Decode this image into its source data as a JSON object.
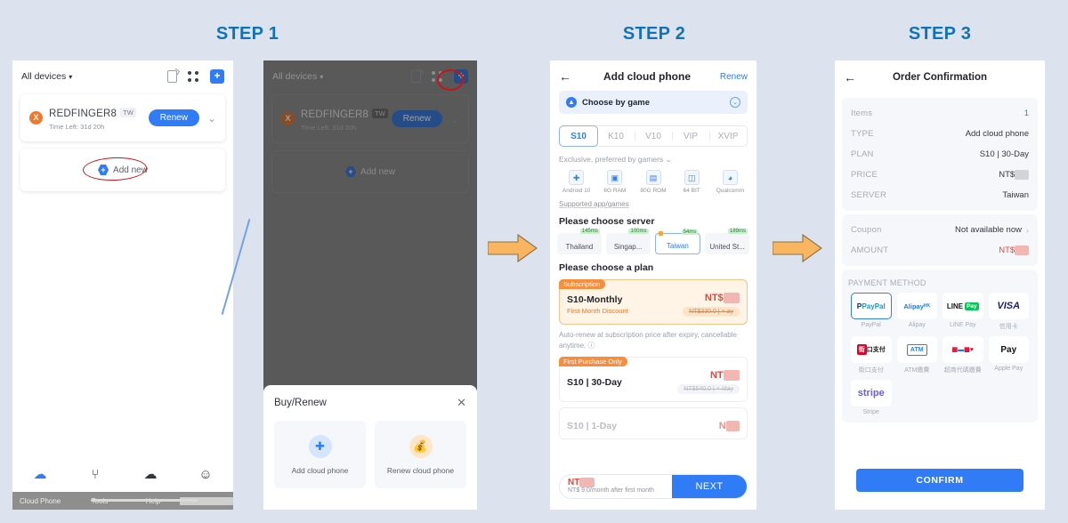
{
  "steps": {
    "step1": "STEP 1",
    "step2": "STEP 2",
    "step3": "STEP 3"
  },
  "panel1": {
    "device_selector": "All devices",
    "caret": "▾",
    "device": {
      "badge": "X",
      "name": "REDFINGER8",
      "region_tag": "TW",
      "time_left": "Time Left: 31d 20h",
      "renew_label": "Renew",
      "chevron": "⌄"
    },
    "add_new_label": "Add new",
    "bottom_nav": [
      {
        "label": "Cloud Phone",
        "glyph": "☁",
        "active": true
      },
      {
        "label": "Tools",
        "glyph": "⑂",
        "active": false
      },
      {
        "label": "Help",
        "glyph": "☁",
        "active": false
      },
      {
        "label": "",
        "glyph": "☺",
        "active": false
      }
    ],
    "taskbar": [
      "Cloud Phone",
      "Tools",
      "Help",
      ""
    ]
  },
  "panel2": {
    "device_selector": "All devices",
    "device": {
      "badge": "X",
      "name": "REDFINGER8",
      "region_tag": "TW",
      "time_left": "Time Left: 31d 20h",
      "renew_label": "Renew",
      "chevron": "⌄"
    },
    "add_new_label": "Add new",
    "sheet": {
      "title": "Buy/Renew",
      "close": "✕",
      "options": [
        {
          "label": "Add cloud phone",
          "glyph": "+"
        },
        {
          "label": "Renew cloud phone",
          "glyph": "💰"
        }
      ]
    }
  },
  "panel3": {
    "back": "←",
    "title": "Add cloud phone",
    "renew_link": "Renew",
    "choose_by_game": "Choose by game",
    "tabs": [
      {
        "label": "S10",
        "selected": true
      },
      {
        "label": "K10",
        "selected": false
      },
      {
        "label": "V10",
        "selected": false
      },
      {
        "label": "VIP",
        "selected": false
      },
      {
        "label": "XVIP",
        "selected": false
      }
    ],
    "exclusive_note": "Exclusive, preferred by gamers ⌄",
    "specs": [
      {
        "label": "Android 10",
        "glyph": "✚"
      },
      {
        "label": "6G RAM",
        "glyph": "▣"
      },
      {
        "label": "80G ROM",
        "glyph": "▤"
      },
      {
        "label": "64 BIT",
        "glyph": "◫"
      },
      {
        "label": "Qualcomm",
        "glyph": "◕"
      }
    ],
    "supported_link": "Supported app/games",
    "server_section_title": "Please choose server",
    "servers": [
      {
        "name": "Thailand",
        "ping": "145ms",
        "selected": false
      },
      {
        "name": "Singap...",
        "ping": "100ms",
        "selected": false
      },
      {
        "name": "Taiwan",
        "ping": "54ms",
        "selected": true
      },
      {
        "name": "United St...",
        "ping": "189ms",
        "selected": false
      }
    ],
    "plan_section_title": "Please choose a plan",
    "plans": [
      {
        "flag": "Subscription",
        "name": "S10-Monthly",
        "sub": "First Month Discount",
        "price_prefix": "NT$",
        "price_redacted": true,
        "strike": "NT$330.0  |  ×      ay",
        "promo": true,
        "dim": false
      },
      {
        "flag": "First Purchase Only",
        "name": "S10 | 30-Day",
        "sub": "",
        "price_prefix": "NT",
        "price_redacted": true,
        "strike": "NT$540.0  |  ×        /day",
        "promo": false,
        "dim": false
      },
      {
        "flag": "",
        "name": "S10 | 1-Day",
        "sub": "",
        "price_prefix": "N",
        "price_redacted": true,
        "strike": "",
        "promo": false,
        "dim": true
      }
    ],
    "auto_renew_note": "Auto-renew at subscription price after expiry, cancellable anytime. ⓘ",
    "footer": {
      "price_prefix": "NT",
      "price_sub": "NT$    9.0/month after first month",
      "next_label": "NEXT"
    }
  },
  "panel4": {
    "back": "←",
    "title": "Order Confirmation",
    "summary": [
      {
        "key": "Items",
        "value": "1",
        "style": "blue"
      },
      {
        "key": "TYPE",
        "value": "Add cloud phone",
        "style": ""
      },
      {
        "key": "PLAN",
        "value": "S10 | 30-Day",
        "style": ""
      },
      {
        "key": "PRICE",
        "value": "NT$",
        "style": "redacted-gray"
      },
      {
        "key": "SERVER",
        "value": "Taiwan",
        "style": ""
      }
    ],
    "coupon": {
      "key": "Coupon",
      "value": "Not available now",
      "arrow": "›"
    },
    "amount": {
      "key": "AMOUNT",
      "value": "NT$",
      "style": "redacted-red"
    },
    "payment_title": "PAYMENT METHOD",
    "payment_methods": [
      {
        "label": "PayPal",
        "mark": "PayPal",
        "selected": true
      },
      {
        "label": "Alipay",
        "mark": "AlipayHK",
        "selected": false
      },
      {
        "label": "LINE Pay",
        "mark": "LINE Pay",
        "selected": false
      },
      {
        "label": "信用卡",
        "mark": "VISA",
        "selected": false
      },
      {
        "label": "街口支付",
        "mark": "街口支付",
        "selected": false
      },
      {
        "label": "ATM繳費",
        "mark": "ATM",
        "selected": false
      },
      {
        "label": "超商代碼繳費",
        "mark": "超商",
        "selected": false
      },
      {
        "label": "Apple Pay",
        "mark": "Pay",
        "selected": false
      },
      {
        "label": "Stripe",
        "mark": "stripe",
        "selected": false
      }
    ],
    "confirm_label": "CONFIRM"
  },
  "colors": {
    "accent_blue": "#2f7cf6",
    "step_blue": "#1073b8",
    "arrow_orange": "#f9b560",
    "annotation_red": "#c6141b",
    "background": "#dde2ef"
  }
}
